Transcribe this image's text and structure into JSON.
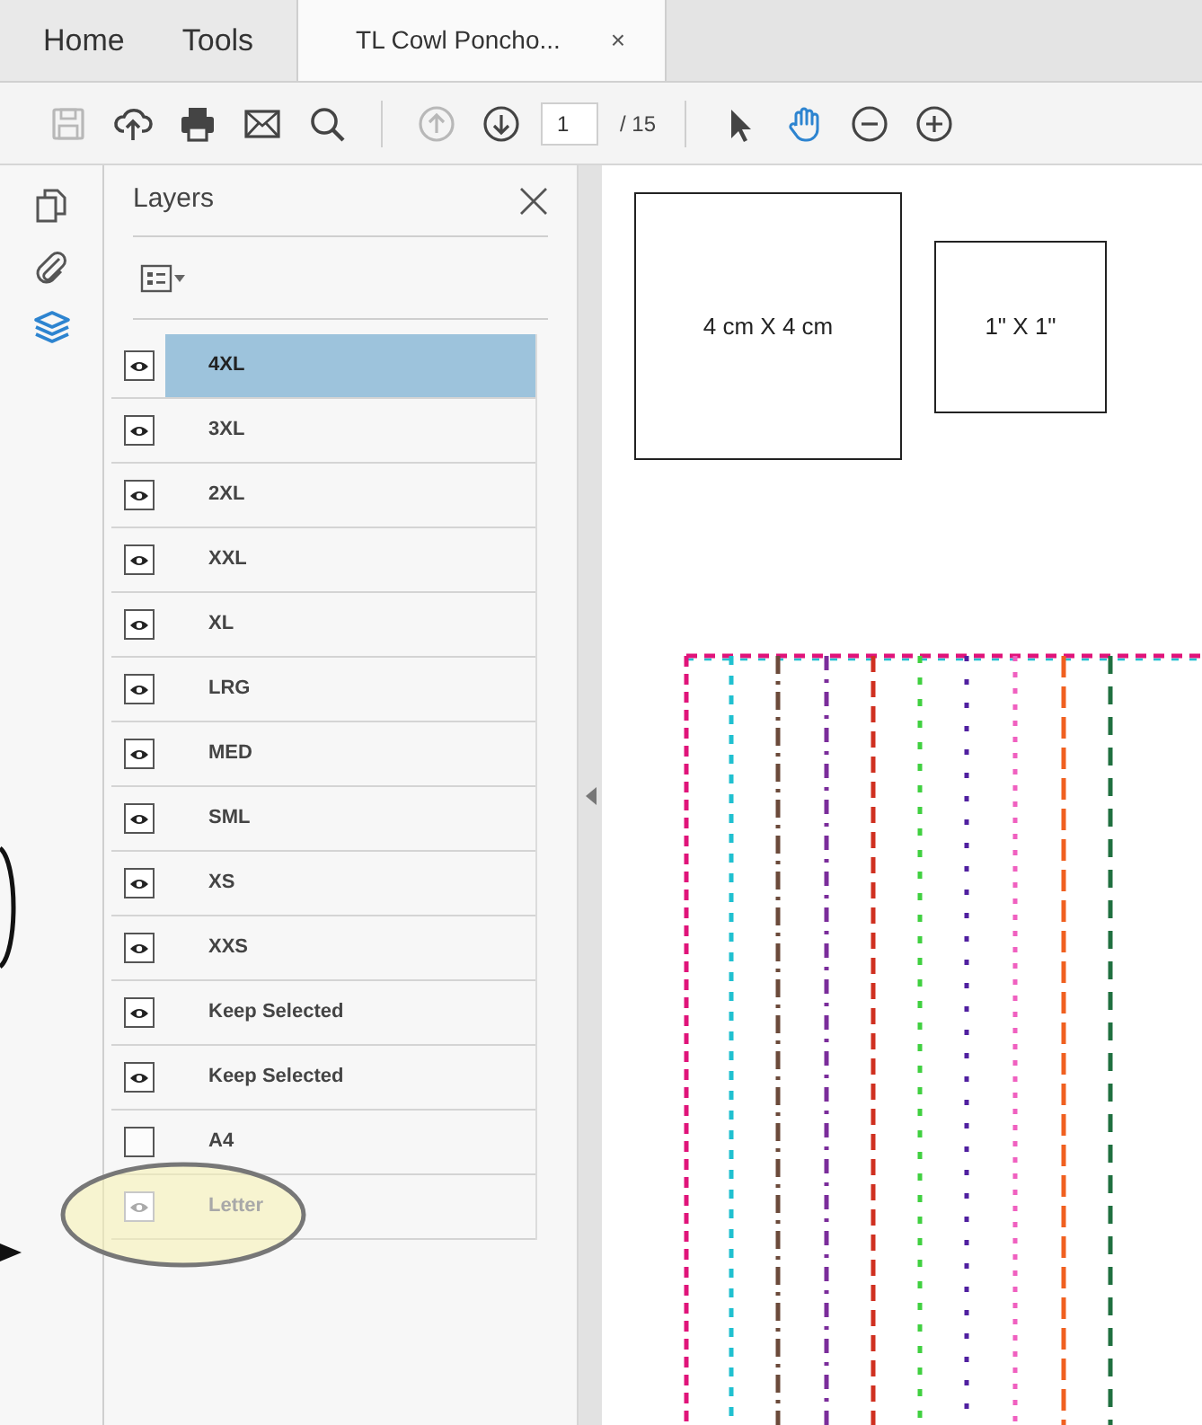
{
  "tabs": [
    {
      "label": "Home",
      "selected": false,
      "kind": "nav"
    },
    {
      "label": "Tools",
      "selected": false,
      "kind": "nav"
    },
    {
      "label": "TL Cowl Poncho...",
      "close": "×",
      "selected": true,
      "kind": "document"
    }
  ],
  "toolbar": {
    "file_tools": [
      {
        "kind": "save",
        "disabled": true
      },
      {
        "kind": "upload",
        "disabled": false
      },
      {
        "kind": "print",
        "disabled": false
      },
      {
        "kind": "mail",
        "disabled": false
      },
      {
        "kind": "search",
        "disabled": false
      }
    ],
    "page_tools": [
      {
        "kind": "prev-page",
        "disabled": true
      },
      {
        "kind": "next-page",
        "disabled": false
      }
    ],
    "page_value": "1",
    "page_total": "/ 15",
    "modes": [
      {
        "kind": "pointer",
        "selected": false
      },
      {
        "kind": "hand",
        "selected": true
      }
    ],
    "zoom_tools": [
      {
        "kind": "zoom-out"
      },
      {
        "kind": "zoom-in"
      }
    ]
  },
  "rail": [
    {
      "kind": "pages",
      "selected": false
    },
    {
      "kind": "attachments",
      "selected": false
    },
    {
      "kind": "layers",
      "selected": true
    }
  ],
  "layers_panel": {
    "title": "Layers",
    "layers": [
      {
        "name": "4XL",
        "visible": true,
        "selected": true,
        "disabled": false
      },
      {
        "name": "3XL",
        "visible": true,
        "selected": false,
        "disabled": false
      },
      {
        "name": "2XL",
        "visible": true,
        "selected": false,
        "disabled": false
      },
      {
        "name": "XXL",
        "visible": true,
        "selected": false,
        "disabled": false
      },
      {
        "name": "XL",
        "visible": true,
        "selected": false,
        "disabled": false
      },
      {
        "name": "LRG",
        "visible": true,
        "selected": false,
        "disabled": false
      },
      {
        "name": "MED",
        "visible": true,
        "selected": false,
        "disabled": false
      },
      {
        "name": "SML",
        "visible": true,
        "selected": false,
        "disabled": false
      },
      {
        "name": "XS",
        "visible": true,
        "selected": false,
        "disabled": false
      },
      {
        "name": "XXS",
        "visible": true,
        "selected": false,
        "disabled": false
      },
      {
        "name": "Keep Selected",
        "visible": true,
        "selected": false,
        "disabled": false
      },
      {
        "name": "Keep Selected",
        "visible": true,
        "selected": false,
        "disabled": false
      },
      {
        "name": "A4",
        "visible": false,
        "selected": false,
        "disabled": false
      },
      {
        "name": "Letter",
        "visible": true,
        "selected": false,
        "disabled": true,
        "highlighted": true
      }
    ]
  },
  "document": {
    "test_squares": [
      {
        "label": "4 cm X 4 cm",
        "kind": "large"
      },
      {
        "label": "1\" X 1\"",
        "kind": "small"
      }
    ]
  }
}
